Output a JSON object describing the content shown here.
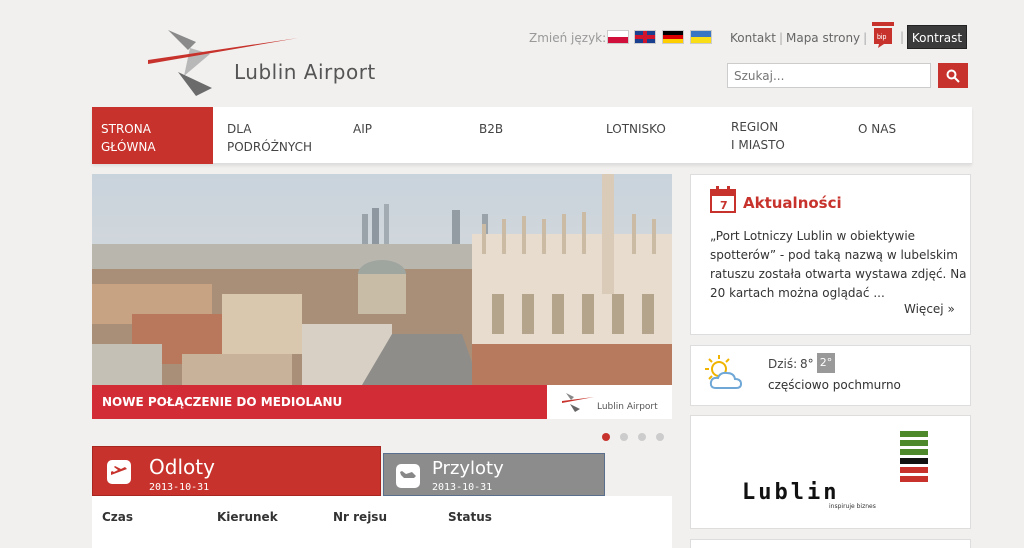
{
  "header": {
    "logo_text": "Lublin Airport",
    "language_label": "Zmień język:",
    "languages": [
      "Polski",
      "English",
      "Deutsch",
      "Українська"
    ],
    "links": {
      "contact": "Kontakt",
      "sitemap": "Mapa strony"
    },
    "bip_label": "bip",
    "contrast_label": "Kontrast",
    "search_placeholder": "Szukaj..."
  },
  "nav": {
    "items": [
      {
        "line1": "STRONA",
        "line2": "GŁÓWNA",
        "active": true
      },
      {
        "line1": "DLA",
        "line2": "PODRÓŻNYCH"
      },
      {
        "line1": "AIP",
        "line2": ""
      },
      {
        "line1": "B2B",
        "line2": ""
      },
      {
        "line1": "LOTNISKO",
        "line2": ""
      },
      {
        "line1": "REGION",
        "line2": "I MIASTO"
      },
      {
        "line1": "O NAS",
        "line2": ""
      }
    ]
  },
  "hero": {
    "caption": "NOWE POŁĄCZENIE DO MEDIOLANU",
    "logo_text": "Lublin Airport",
    "slide_count": 4,
    "active_slide": 1
  },
  "flights": {
    "departures": {
      "title": "Odloty",
      "date": "2013-10-31"
    },
    "arrivals": {
      "title": "Przyloty",
      "date": "2013-10-31"
    },
    "columns": [
      "Czas",
      "Kierunek",
      "Nr rejsu",
      "Status"
    ]
  },
  "news": {
    "calendar_day": "7",
    "title": "Aktualności",
    "text": "„Port Lotniczy Lublin w obiektywie spotterów” - pod taką nazwą w lubelskim ratuszu została otwarta wystawa zdjęć. Na 20 kartach można oglądać ...",
    "more": "Więcej »"
  },
  "weather": {
    "today_label": "Dziś:",
    "temp": "8°",
    "low": "2°",
    "description": "częściowo pochmurno"
  },
  "banner": {
    "word": "Lublin",
    "tagline": "inspiruje biznes"
  },
  "colors": {
    "accent": "#c7332c",
    "background": "#f1f0ef",
    "arrivals_tab": "#8c8c8c"
  }
}
